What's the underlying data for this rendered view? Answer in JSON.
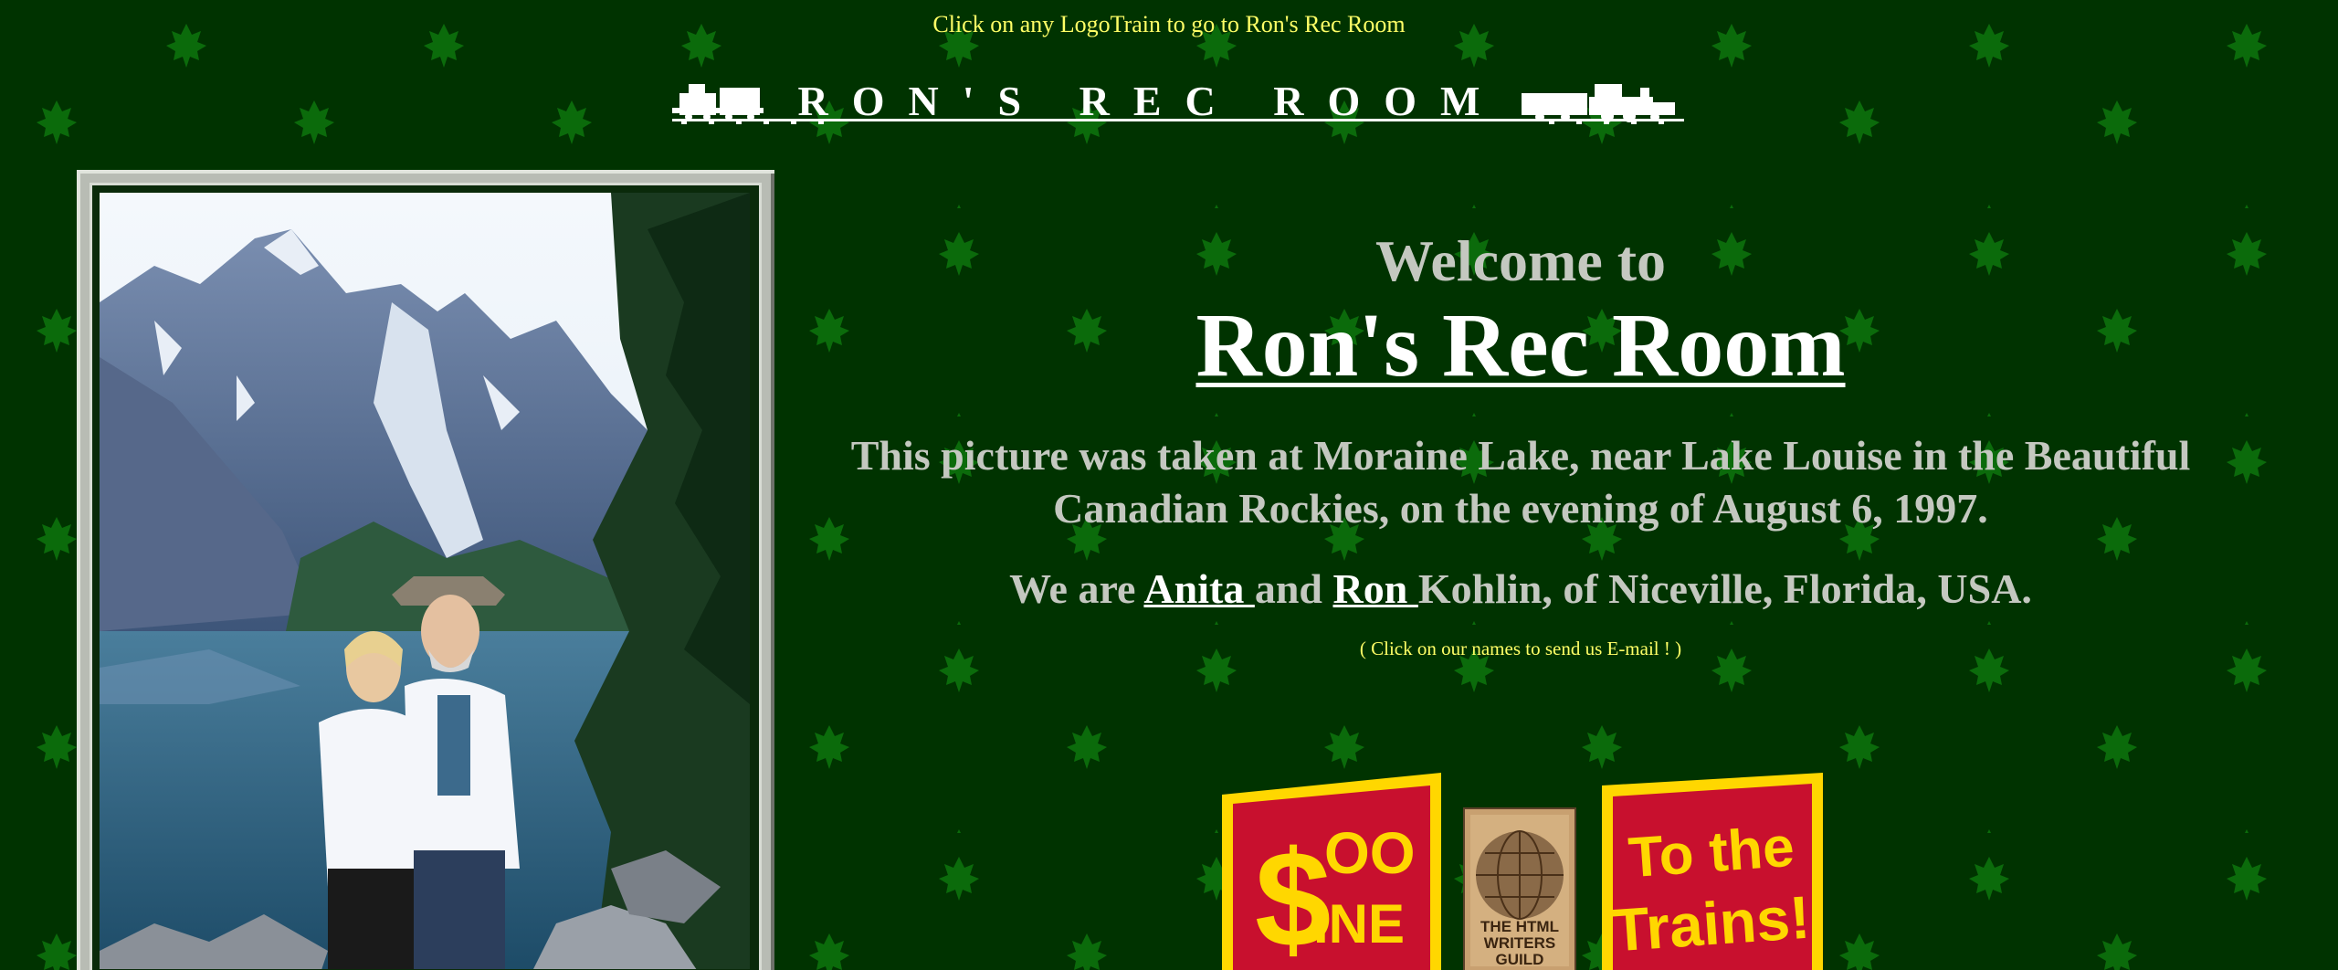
{
  "header": {
    "note": "Click on any LogoTrain to go to Ron's Rec Room",
    "logo_text": "RON'S REC ROOM"
  },
  "main": {
    "welcome": "Welcome to",
    "title": "Ron's Rec Room",
    "caption": "This picture was taken at Moraine Lake, near Lake Louise in the Beautiful Canadian Rockies, on the evening of August 6, 1997.",
    "we_are_prefix": "We are ",
    "name_anita": "Anita ",
    "and_word": "and ",
    "name_ron": "Ron ",
    "we_are_suffix": "Kohlin, of Niceville, Florida, USA.",
    "email_note": "( Click on our names to send us E-mail ! )"
  },
  "badges": {
    "soo_line_line1": "OO",
    "soo_line_line2": "INE",
    "hwg_line1": "THE HTML",
    "hwg_line2": "WRITERS",
    "hwg_line3": "GUILD",
    "trains_line1": "To the",
    "trains_line2": "Trains!"
  },
  "colors": {
    "background": "#003300",
    "leaf": "#0b6b0b",
    "highlight_text": "#ffff66",
    "body_text": "#c4c8c0",
    "badge_red": "#c8102e",
    "badge_yellow": "#ffd700"
  }
}
